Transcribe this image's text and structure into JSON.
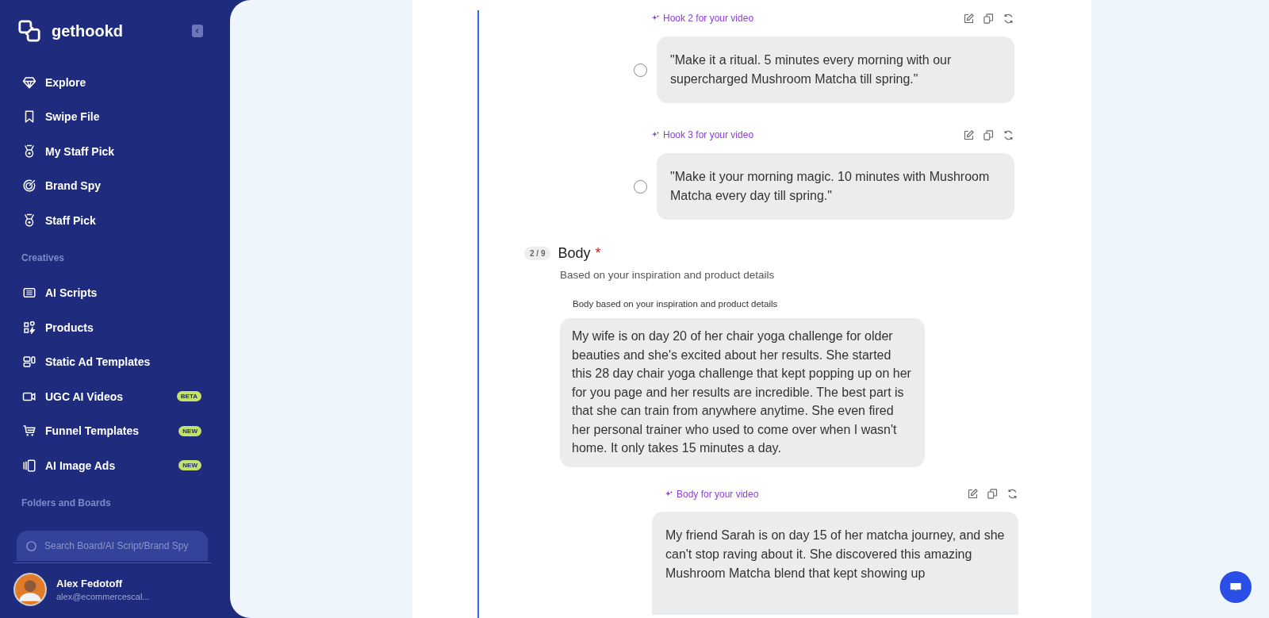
{
  "sidebar": {
    "brand": "gethookd",
    "nav": [
      {
        "label": "Explore",
        "selected": false
      },
      {
        "label": "Swipe File",
        "selected": false
      },
      {
        "label": "My Staff Pick",
        "selected": false
      },
      {
        "label": "Brand Spy",
        "selected": false
      },
      {
        "label": "Staff Pick",
        "selected": false
      }
    ],
    "creatives": {
      "title": "Creatives",
      "items": [
        {
          "label": "AI Scripts"
        },
        {
          "label": "Products"
        },
        {
          "label": "Static Ad Templates"
        },
        {
          "label": "UGC AI Videos",
          "badge": "BETA"
        },
        {
          "label": "Funnel Templates",
          "badge": "NEW"
        },
        {
          "label": "AI Image Ads",
          "badge": "NEW"
        }
      ]
    },
    "folders": {
      "title": "Folders and Boards"
    },
    "search": {
      "placeholder": "Search Board/AI Script/Brand Spy"
    },
    "user": {
      "name": "Alex Fedotoff",
      "email": "alex@ecommercescal..."
    }
  },
  "hooks": [
    {
      "label": "Hook 2 for your video",
      "text": "\"Make it a ritual. 5 minutes every morning with our supercharged Mushroom Matcha till spring.\"",
      "selected": false
    },
    {
      "label": "Hook 3 for your video",
      "text": "\"Make it your morning magic. 10 minutes with Mushroom Matcha every day till spring.\"",
      "selected": false
    }
  ],
  "body": {
    "step": "2 / 9",
    "title": "Body",
    "required": "*",
    "subtitle": "Based on your inspiration and product details",
    "source_label": "Body based on your inspiration and product details",
    "source_text": "My wife is on day 20 of her chair yoga challenge for older beauties and she's excited about her results. She started this 28 day chair yoga challenge that kept popping up on her for you page and her results are incredible. The best part is that she can train from anywhere anytime. She even fired her personal trainer who used to come over when I wasn't home. It only takes 15 minutes a day.",
    "video_label": "Body for your video",
    "video_text": "My friend Sarah is on day 15 of her matcha journey, and she can't stop raving about it. She discovered this amazing Mushroom Matcha blend that kept showing up"
  }
}
